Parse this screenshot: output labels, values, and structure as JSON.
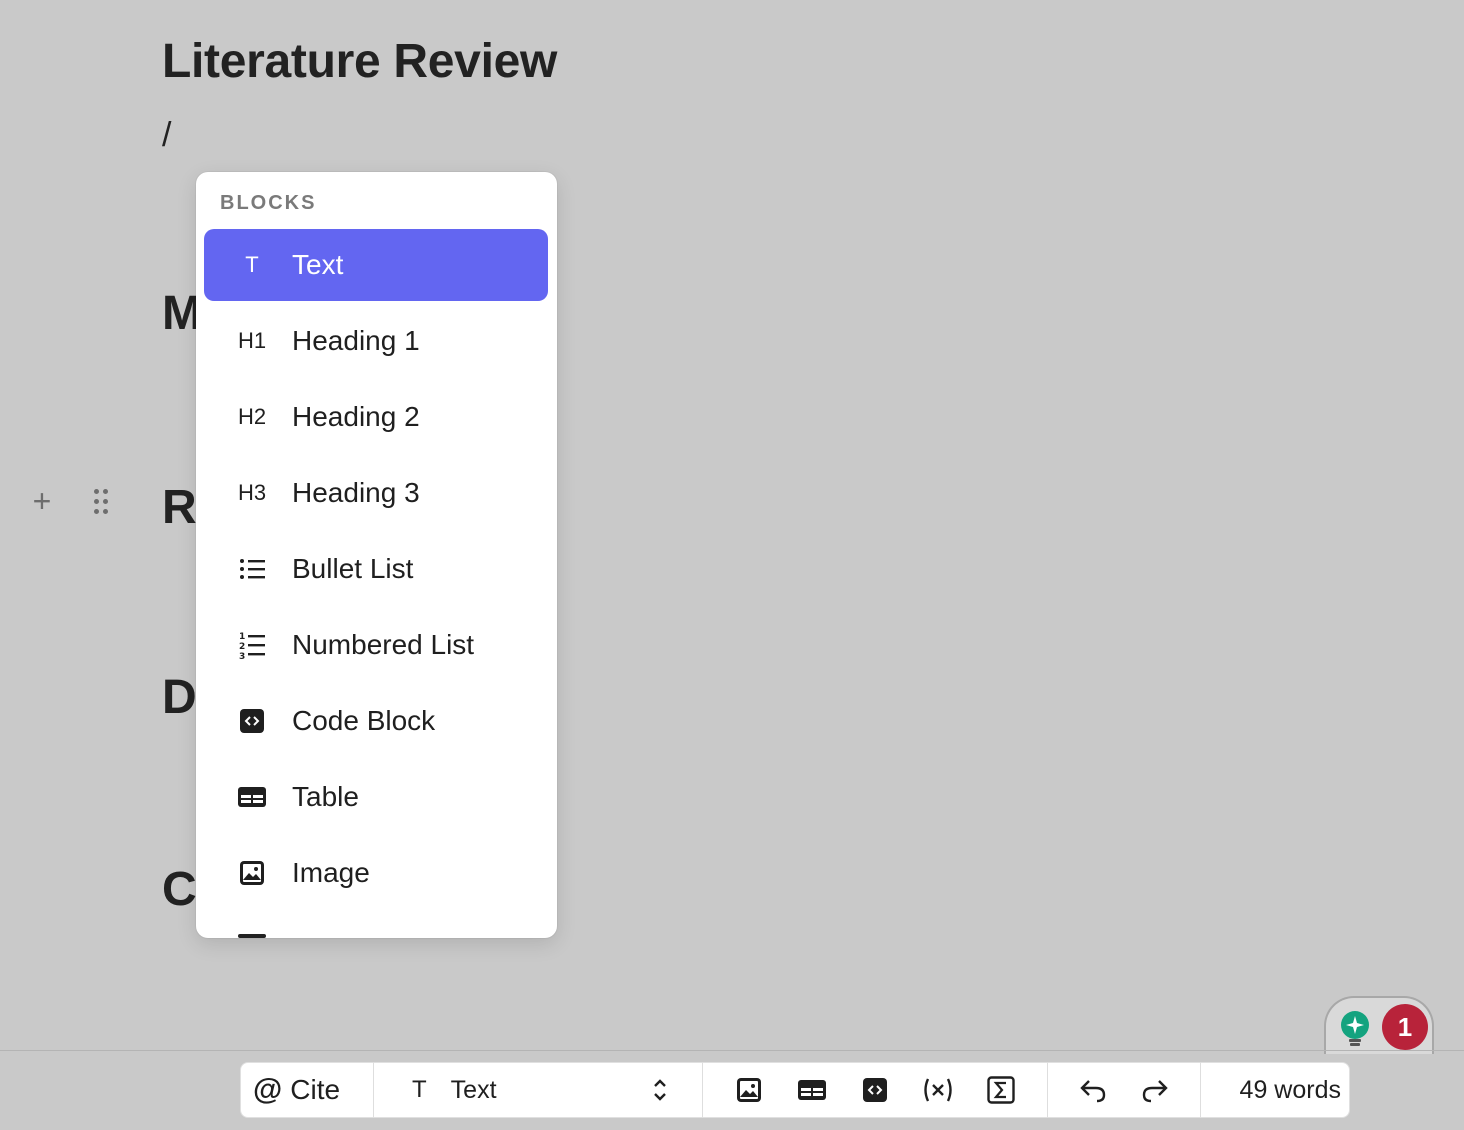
{
  "document": {
    "title": "Literature Review",
    "slash_input": "/",
    "heading_peeks": [
      "M",
      "R",
      "D",
      "C"
    ]
  },
  "slash_menu": {
    "section_label": "BLOCKS",
    "items": [
      {
        "icon_text": "T",
        "icon": "text-icon",
        "label": "Text",
        "active": true
      },
      {
        "icon_text": "H1",
        "icon": "heading1-icon",
        "label": "Heading 1"
      },
      {
        "icon_text": "H2",
        "icon": "heading2-icon",
        "label": "Heading 2"
      },
      {
        "icon_text": "H3",
        "icon": "heading3-icon",
        "label": "Heading 3"
      },
      {
        "icon_text": "",
        "icon": "bullet-list-icon",
        "label": "Bullet List"
      },
      {
        "icon_text": "",
        "icon": "numbered-list-icon",
        "label": "Numbered List"
      },
      {
        "icon_text": "",
        "icon": "code-block-icon",
        "label": "Code Block"
      },
      {
        "icon_text": "",
        "icon": "table-icon",
        "label": "Table"
      },
      {
        "icon_text": "",
        "icon": "image-icon",
        "label": "Image"
      }
    ]
  },
  "toolbar": {
    "cite_label": "Cite",
    "block_type_icon_text": "T",
    "block_type_label": "Text",
    "insert_buttons": [
      "image-icon",
      "table-icon",
      "code-block-icon",
      "variable-icon",
      "sigma-icon"
    ],
    "undo_icon": "undo-icon",
    "redo_icon": "redo-icon",
    "word_count": "49 words"
  },
  "assistant": {
    "badge_count": "1"
  },
  "colors": {
    "accent": "#6366f1",
    "badge": "#b8233a",
    "bulb": "#14a37f",
    "background": "#c9c9c9"
  }
}
